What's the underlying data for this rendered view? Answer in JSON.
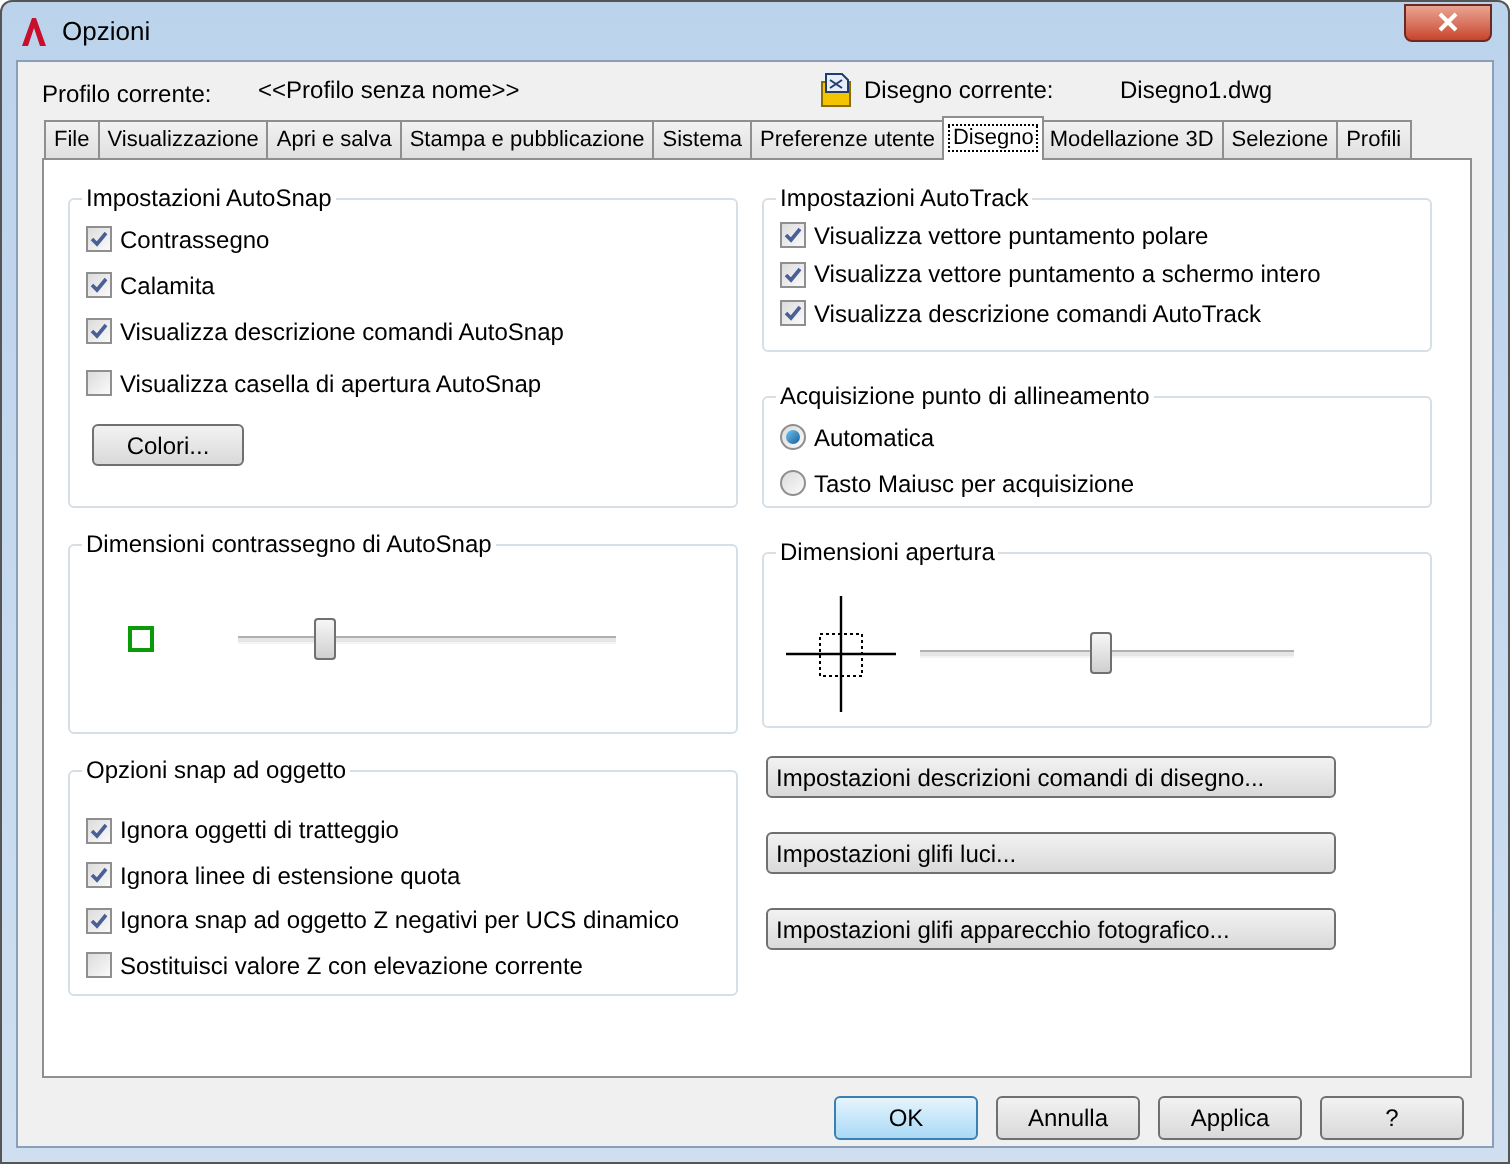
{
  "window": {
    "title": "Opzioni"
  },
  "profile": {
    "label": "Profilo corrente:",
    "value": "<<Profilo senza nome>>"
  },
  "drawing": {
    "label": "Disegno corrente:",
    "value": "Disegno1.dwg"
  },
  "tabs": [
    {
      "label": "File",
      "selected": false
    },
    {
      "label": "Visualizzazione",
      "selected": false
    },
    {
      "label": "Apri e salva",
      "selected": false
    },
    {
      "label": "Stampa e pubblicazione",
      "selected": false
    },
    {
      "label": "Sistema",
      "selected": false
    },
    {
      "label": "Preferenze utente",
      "selected": false
    },
    {
      "label": "Disegno",
      "selected": true
    },
    {
      "label": "Modellazione 3D",
      "selected": false
    },
    {
      "label": "Selezione",
      "selected": false
    },
    {
      "label": "Profili",
      "selected": false
    }
  ],
  "autosnap": {
    "title": "Impostazioni AutoSnap",
    "options": [
      {
        "label": "Contrassegno",
        "checked": true
      },
      {
        "label": "Calamita",
        "checked": true
      },
      {
        "label": "Visualizza descrizione comandi AutoSnap",
        "checked": true
      },
      {
        "label": "Visualizza casella di apertura AutoSnap",
        "checked": false
      }
    ],
    "button": "Colori..."
  },
  "autotrack": {
    "title": "Impostazioni AutoTrack",
    "options": [
      {
        "label": "Visualizza vettore puntamento polare",
        "checked": true
      },
      {
        "label": "Visualizza vettore puntamento a schermo intero",
        "checked": true
      },
      {
        "label": "Visualizza descrizione comandi AutoTrack",
        "checked": true
      }
    ]
  },
  "alignment": {
    "title": "Acquisizione punto di allineamento",
    "options": [
      {
        "label": "Automatica",
        "selected": true
      },
      {
        "label": "Tasto Maiusc per acquisizione",
        "selected": false
      }
    ]
  },
  "marker_size": {
    "title": "Dimensioni contrassegno di AutoSnap",
    "level": 0.23
  },
  "aperture_size": {
    "title": "Dimensioni apertura",
    "level": 0.48
  },
  "object_snap": {
    "title": "Opzioni snap ad oggetto",
    "options": [
      {
        "label": "Ignora oggetti di tratteggio",
        "checked": true
      },
      {
        "label": "Ignora linee di estensione quota",
        "checked": true
      },
      {
        "label": "Ignora snap ad oggetto Z negativi per UCS dinamico",
        "checked": true
      },
      {
        "label": "Sostituisci valore Z con elevazione corrente",
        "checked": false
      }
    ]
  },
  "settings_buttons": [
    "Impostazioni descrizioni comandi di disegno...",
    "Impostazioni glifi luci...",
    "Impostazioni glifi apparecchio fotografico..."
  ],
  "buttons": [
    {
      "label": "OK",
      "default": true
    },
    {
      "label": "Annulla",
      "default": false
    },
    {
      "label": "Applica",
      "default": false
    },
    {
      "label": "?",
      "default": false
    }
  ]
}
